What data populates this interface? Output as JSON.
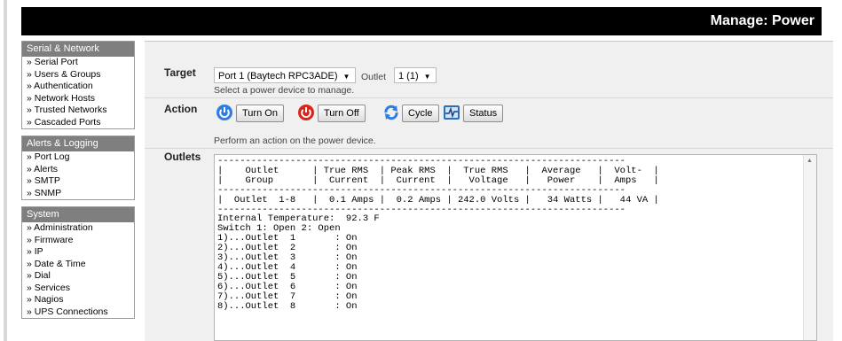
{
  "header": {
    "title": "Manage: Power"
  },
  "sidebar": {
    "sections": [
      {
        "title": "Serial & Network",
        "items": [
          "» Serial Port",
          "» Users & Groups",
          "» Authentication",
          "» Network Hosts",
          "» Trusted Networks",
          "» Cascaded Ports"
        ]
      },
      {
        "title": "Alerts & Logging",
        "items": [
          "» Port Log",
          "» Alerts",
          "» SMTP",
          "» SNMP"
        ]
      },
      {
        "title": "System",
        "items": [
          "» Administration",
          "» Firmware",
          "» IP",
          "» Date & Time",
          "» Dial",
          "» Services",
          "» Nagios",
          "» UPS Connections"
        ]
      }
    ]
  },
  "target": {
    "label": "Target",
    "device": "Port 1 (Baytech RPC3ADE)",
    "outlet_label": "Outlet",
    "outlet_value": "1 (1)",
    "help": "Select a power device to manage."
  },
  "action": {
    "label": "Action",
    "turn_on": "Turn On",
    "turn_off": "Turn Off",
    "cycle": "Cycle",
    "status": "Status",
    "help": "Perform an action on the power device."
  },
  "outlets": {
    "label": "Outlets",
    "lines": [
      "-------------------------------------------------------------------------",
      "|    Outlet      | True RMS  | Peak RMS  |  True RMS   |  Average   |  Volt-  |",
      "|    Group       |  Current  |  Current  |   Voltage   |   Power    |  Amps   |",
      "-------------------------------------------------------------------------",
      "|  Outlet  1-8   |  0.1 Amps |  0.2 Amps | 242.0 Volts |   34 Watts |   44 VA |",
      "-------------------------------------------------------------------------",
      "Internal Temperature:  92.3 F",
      "Switch 1: Open 2: Open",
      "1)...Outlet  1       : On",
      "2)...Outlet  2       : On",
      "3)...Outlet  3       : On",
      "4)...Outlet  4       : On",
      "5)...Outlet  5       : On",
      "6)...Outlet  6       : On",
      "7)...Outlet  7       : On",
      "8)...Outlet  8       : On"
    ]
  },
  "colors": {
    "header_bg": "#000000",
    "menu_head_bg": "#7f7f7f",
    "content_bg": "#f0f0f0"
  }
}
